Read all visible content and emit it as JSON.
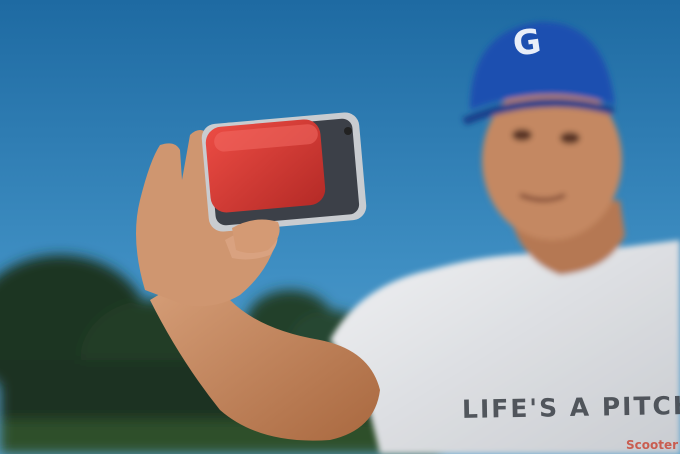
{
  "scene": {
    "shirt_text": "LIFE'S A PITCH",
    "shirt_subtext": "Scooter",
    "cap_logo": "G"
  },
  "colors": {
    "sky_top": "#1f6fa8",
    "sky_bottom": "#4b9dcc",
    "cap": "#1f4fb0",
    "case": "#d63a35",
    "shirt": "#e4e6ea",
    "skin": "#c98a5e",
    "trees": "#1f3a22"
  }
}
